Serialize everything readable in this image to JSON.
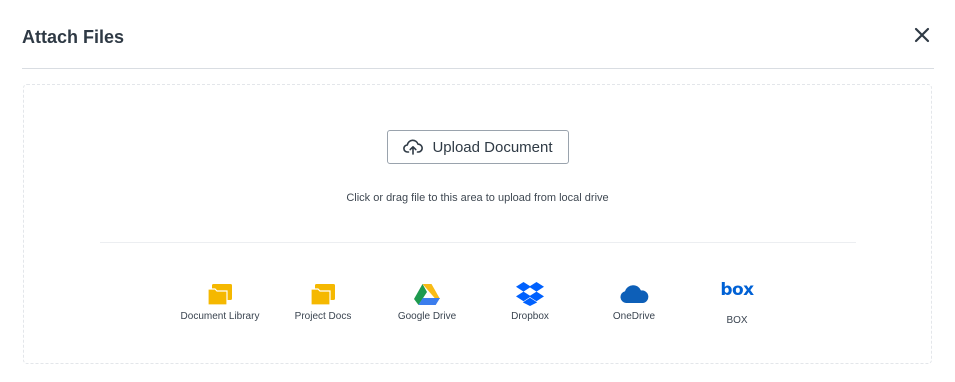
{
  "dialog": {
    "title": "Attach Files",
    "close_icon": "close-icon"
  },
  "upload": {
    "button_label": "Upload Document",
    "button_icon": "cloud-upload-icon",
    "hint": "Click or drag file to this area to upload from local drive"
  },
  "sources": [
    {
      "label": "Document Library",
      "icon": "folder-icon",
      "color": "#f5b800"
    },
    {
      "label": "Project Docs",
      "icon": "folder-icon",
      "color": "#f5b800"
    },
    {
      "label": "Google Drive",
      "icon": "google-drive-icon"
    },
    {
      "label": "Dropbox",
      "icon": "dropbox-icon",
      "color": "#0061fe"
    },
    {
      "label": "OneDrive",
      "icon": "onedrive-icon",
      "color": "#0d5fb8"
    },
    {
      "label": "BOX",
      "icon": "box-icon",
      "color": "#0061d5",
      "logo_text": "box"
    }
  ]
}
